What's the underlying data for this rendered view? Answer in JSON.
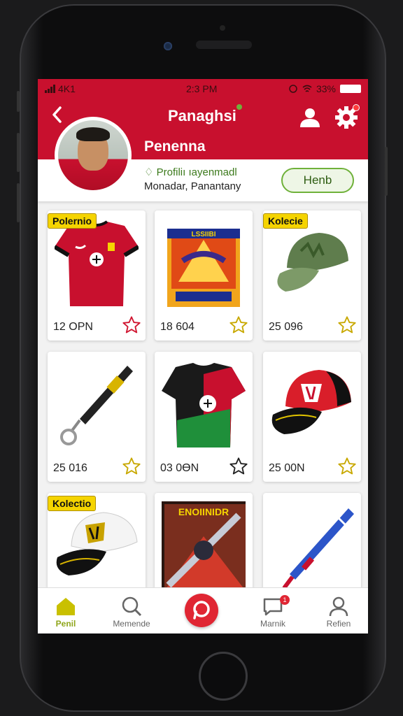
{
  "status_bar": {
    "carrier": "4K1",
    "time": "2:3 PM",
    "battery": "33%"
  },
  "header": {
    "title": "Panaghsi",
    "back_icon": "chevron-left-icon",
    "user_icon": "user-icon",
    "settings_icon": "gear-icon"
  },
  "profile": {
    "name": "Penenna",
    "line1": "Profiliı ıayenmadl",
    "line2": "Monadar, Panantany",
    "follow_label": "Henb"
  },
  "products": [
    {
      "tag": "Polernio",
      "price": "12 OPN",
      "item": "red-jersey",
      "favorited": false,
      "star_color": "#d01530"
    },
    {
      "tag": "",
      "price": "18 604",
      "item": "trading-card-box",
      "favorited": false,
      "star_color": "#c8a800"
    },
    {
      "tag": "Kolecie",
      "price": "25 096",
      "item": "green-cap",
      "favorited": false,
      "star_color": "#c8a800"
    },
    {
      "tag": "",
      "price": "25 016",
      "item": "lanyard",
      "favorited": false,
      "star_color": "#c8a800"
    },
    {
      "tag": "",
      "price": "03 0ӨN",
      "item": "black-green-jersey",
      "favorited": false,
      "star_color": "#222222"
    },
    {
      "tag": "",
      "price": "25 00N",
      "item": "red-cap",
      "favorited": false,
      "star_color": "#c8a800"
    },
    {
      "tag": "Kolectio",
      "price": "",
      "item": "white-cap",
      "favorited": false,
      "star_color": "#c8a800"
    },
    {
      "tag": "",
      "price": "",
      "item": "poster",
      "favorited": false,
      "star_color": "#c8a800"
    },
    {
      "tag": "",
      "price": "",
      "item": "baseball-bat",
      "favorited": false,
      "star_color": "#c8a800"
    }
  ],
  "poster_text": "ENOIINIDR",
  "tabs": [
    {
      "label": "Penil",
      "icon": "home-icon",
      "active": true
    },
    {
      "label": "Memende",
      "icon": "search-icon",
      "active": false
    },
    {
      "label": "",
      "icon": "chat-logo-icon",
      "active": false
    },
    {
      "label": "Marnik",
      "icon": "message-icon",
      "active": false,
      "badge": "1"
    },
    {
      "label": "Refien",
      "icon": "profile-icon",
      "active": false
    }
  ],
  "colors": {
    "brand_red": "#c8102e",
    "accent_green": "#6fb13a",
    "tag_yellow": "#f5d400"
  }
}
